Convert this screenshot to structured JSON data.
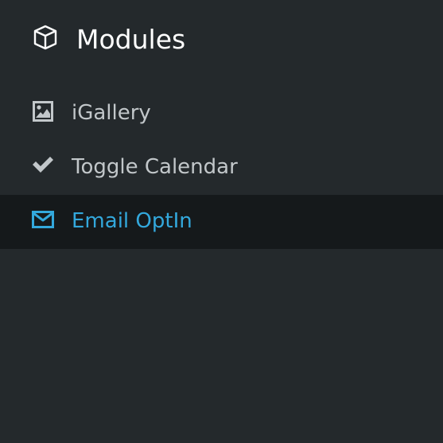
{
  "header": {
    "title": "Modules",
    "icon": "cube-icon"
  },
  "menu": {
    "items": [
      {
        "label": "iGallery",
        "icon": "image-icon",
        "active": false
      },
      {
        "label": "Toggle Calendar",
        "icon": "checkmark-icon",
        "active": false
      },
      {
        "label": "Email OptIn",
        "icon": "envelope-icon",
        "active": true
      }
    ]
  },
  "colors": {
    "background": "#24292c",
    "active_background": "#15191b",
    "text": "#c2c7ca",
    "title": "#ffffff",
    "accent": "#33a8dc"
  }
}
